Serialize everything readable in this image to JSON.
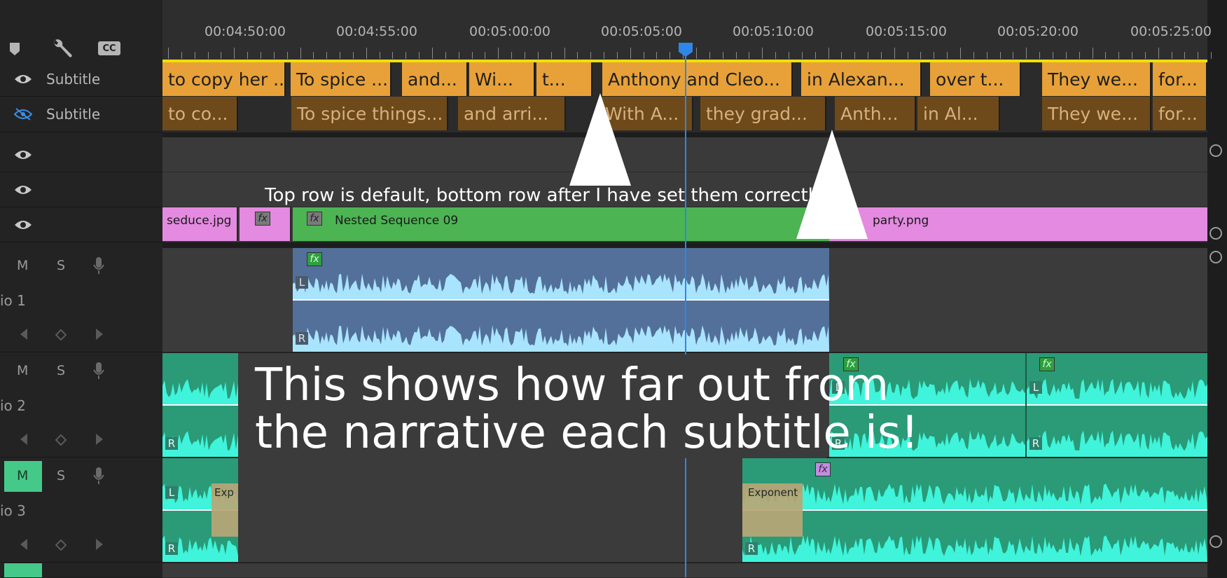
{
  "toolbar": {
    "icons": [
      "marker-icon",
      "wrench-icon",
      "cc-icon"
    ],
    "cc_label": "CC"
  },
  "timecodes": [
    "00:04:50:00",
    "00:04:55:00",
    "00:05:00:00",
    "00:05:05:00",
    "00:05:10:00",
    "00:05:15:00",
    "00:05:20:00",
    "00:05:25:00"
  ],
  "track_headers": {
    "subtitle_label": "Subtitle",
    "mute": "M",
    "solo": "S",
    "audio_1": "io 1",
    "audio_2": "io 2",
    "audio_3": "io 3"
  },
  "subtitle_top": [
    "to copy her ...",
    "To spice ...",
    "and...",
    "Wi...",
    "t...",
    "Anthony and Cleo...",
    "in Alexan...",
    "over t...",
    "They we...",
    "for..."
  ],
  "subtitle_bottom": [
    "to co...",
    "To spice things...",
    "and arri...",
    "With A...",
    "they grad...",
    "Anth...",
    "in Al...",
    "They we...",
    "for..."
  ],
  "video_clips": {
    "clip1": "seduce.jpg",
    "clip3": "Nested Sequence 09",
    "clip4": "party.png",
    "fx": "fx"
  },
  "audio_labels": {
    "left": "L",
    "right": "R",
    "transition_1": "Exp",
    "transition_2": "Exponent"
  },
  "annotations": {
    "top_note": "Top row is default, bottom row after I have set them correctly",
    "big_note_line1": "This shows how far out from",
    "big_note_line2": "the narrative each subtitle is!"
  },
  "colors": {
    "subtitle_top": "#e8a138",
    "subtitle_bottom": "#6e4a1a",
    "video_pink": "#e48ae0",
    "video_green": "#4cb453",
    "audio_blue": "#52709a",
    "audio_teal": "#2a9a77",
    "waveform_light": "#a9e4ff",
    "waveform_teal": "#3ff4da",
    "playhead": "#2f86e8",
    "mute_active": "#45c988"
  }
}
